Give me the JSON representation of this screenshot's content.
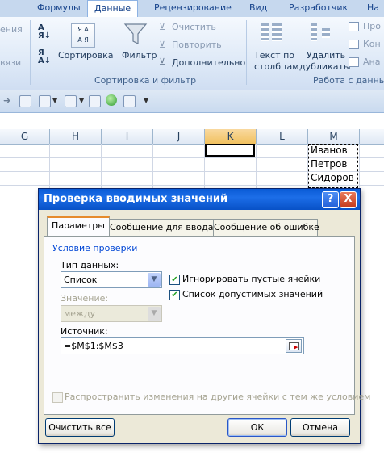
{
  "ribbon": {
    "tabs": [
      "Формулы",
      "Данные",
      "Рецензирование",
      "Вид",
      "Разработчик",
      "На"
    ],
    "partial_left": [
      "ения",
      "вязи"
    ],
    "sort_az_icon": "sort-az-icon",
    "sort_label": "Сортировка",
    "filter_label": "Фильтр",
    "clear_label": "Очистить",
    "reapply_label": "Повторить",
    "advanced_label": "Дополнительно",
    "sort_group_label": "Сортировка и фильтр",
    "text_to_cols_line1": "Текст по",
    "text_to_cols_line2": "столбцам",
    "remove_dup_line1": "Удалить",
    "remove_dup_line2": "дубликаты",
    "data_tools_group": "Работа с данны",
    "right_items": [
      "Про",
      "Кон",
      "Ана"
    ]
  },
  "sheet": {
    "columns": [
      "G",
      "H",
      "I",
      "J",
      "K",
      "L",
      "M"
    ],
    "selected_column": "K",
    "cells_m": [
      "Иванов",
      "Петров",
      "Сидоров"
    ]
  },
  "dialog": {
    "title": "Проверка вводимых значений",
    "help_btn": "?",
    "close_btn": "X",
    "tabs": [
      "Параметры",
      "Сообщение для ввода",
      "Сообщение об ошибке"
    ],
    "section": "Условие проверки",
    "type_label": "Тип данных:",
    "type_value": "Список",
    "value_label": "Значение:",
    "value_value": "между",
    "ignore_blank": "Игнорировать пустые ячейки",
    "dropdown_list": "Список допустимых значений",
    "source_label": "Источник:",
    "source_value": "=$M$1:$M$3",
    "spread_changes": "Распространить изменения на другие ячейки с тем же условием",
    "clear_all": "Очистить все",
    "ok": "ОК",
    "cancel": "Отмена"
  }
}
